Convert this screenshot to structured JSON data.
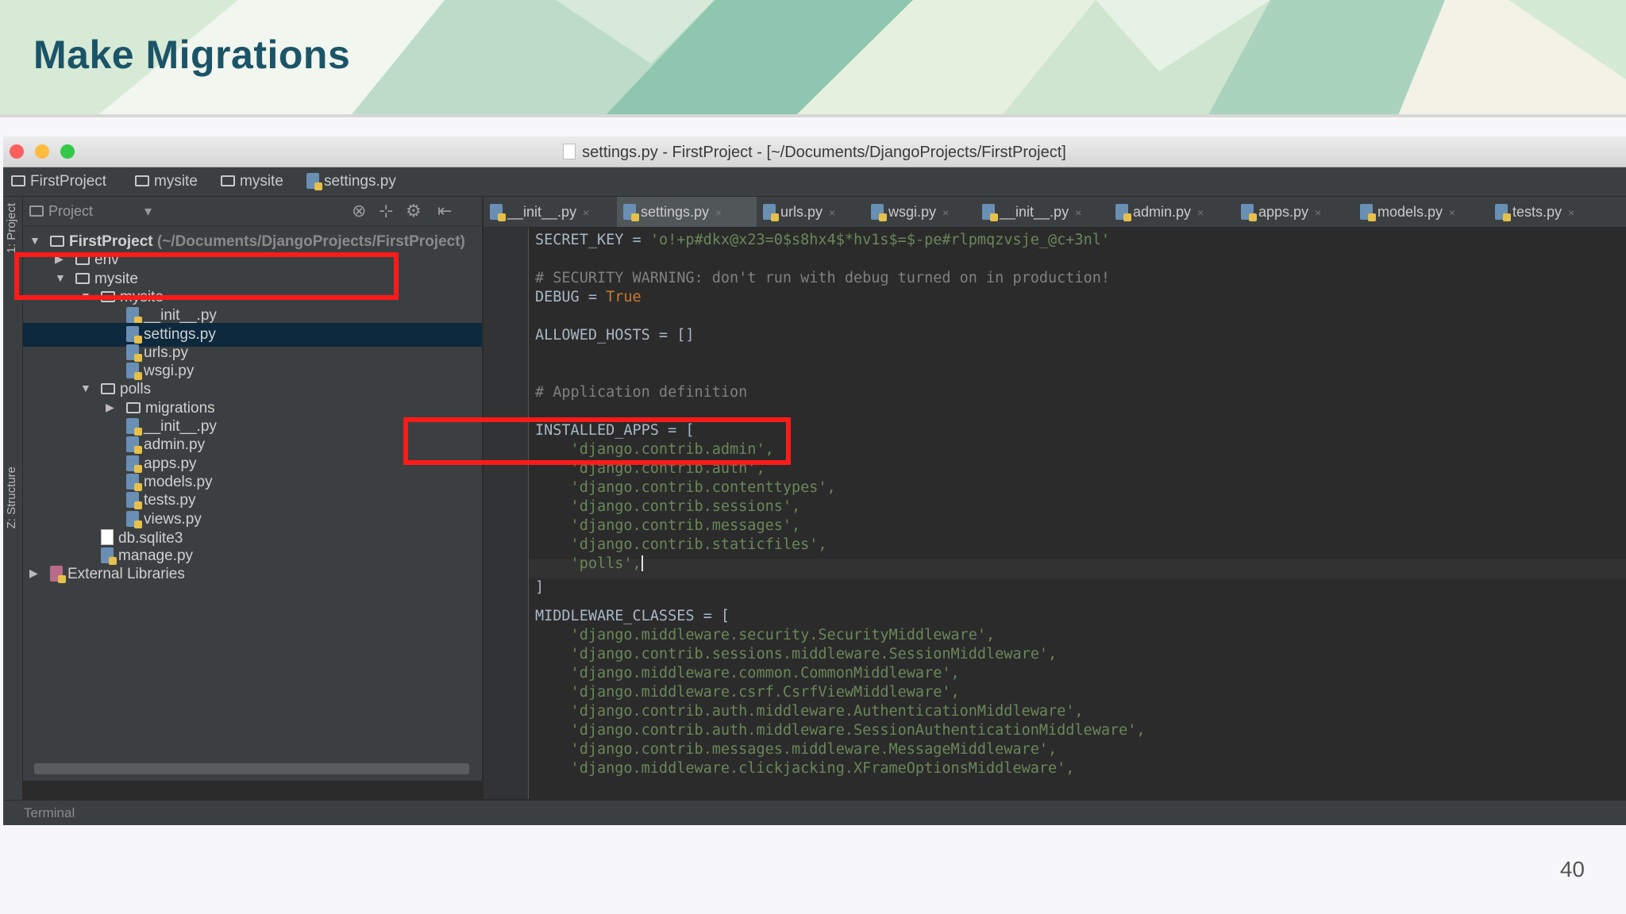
{
  "slide": {
    "title": "Make Migrations",
    "page_number": "40"
  },
  "window": {
    "title": "settings.py - FirstProject - [~/Documents/DjangoProjects/FirstProject]"
  },
  "breadcrumb": [
    "FirstProject",
    "mysite",
    "mysite",
    "settings.py"
  ],
  "side_tabs": {
    "project": "1: Project",
    "structure": "Z: Structure"
  },
  "project_panel": {
    "header_label": "Project",
    "tree": [
      {
        "label": "FirstProject",
        "suffix": "(~/Documents/DjangoProjects/FirstProject)",
        "depth": 0,
        "arrow": "▼",
        "kind": "folder"
      },
      {
        "label": "env",
        "depth": 1,
        "arrow": "▶",
        "kind": "folder"
      },
      {
        "label": "mysite",
        "depth": 1,
        "arrow": "▼",
        "kind": "folder"
      },
      {
        "label": "mysite",
        "depth": 2,
        "arrow": "▼",
        "kind": "folder"
      },
      {
        "label": "__init__.py",
        "depth": 3,
        "kind": "py"
      },
      {
        "label": "settings.py",
        "depth": 3,
        "kind": "py",
        "selected": true
      },
      {
        "label": "urls.py",
        "depth": 3,
        "kind": "py"
      },
      {
        "label": "wsgi.py",
        "depth": 3,
        "kind": "py"
      },
      {
        "label": "polls",
        "depth": 2,
        "arrow": "▼",
        "kind": "folder"
      },
      {
        "label": "migrations",
        "depth": 3,
        "arrow": "▶",
        "kind": "folder"
      },
      {
        "label": "__init__.py",
        "depth": 3,
        "kind": "py"
      },
      {
        "label": "admin.py",
        "depth": 3,
        "kind": "py"
      },
      {
        "label": "apps.py",
        "depth": 3,
        "kind": "py"
      },
      {
        "label": "models.py",
        "depth": 3,
        "kind": "py"
      },
      {
        "label": "tests.py",
        "depth": 3,
        "kind": "py"
      },
      {
        "label": "views.py",
        "depth": 3,
        "kind": "py"
      },
      {
        "label": "db.sqlite3",
        "depth": 2,
        "kind": "file"
      },
      {
        "label": "manage.py",
        "depth": 2,
        "kind": "py"
      },
      {
        "label": "External Libraries",
        "depth": 0,
        "arrow": "▶",
        "kind": "lib"
      }
    ]
  },
  "editor_tabs": [
    "__init__.py",
    "settings.py",
    "urls.py",
    "wsgi.py",
    "__init__.py",
    "admin.py",
    "apps.py",
    "models.py",
    "tests.py"
  ],
  "active_tab": "settings.py",
  "code": {
    "secret_key_name": "SECRET_KEY",
    "secret_key_value": "'o!+p#dkx@x23=0$s8hx4$*hv1s$=$-pe#rlpmqzvsje_@c+3nl'",
    "security_comment": "# SECURITY WARNING: don't run with debug turned on in production!",
    "debug_name": "DEBUG",
    "debug_value": "True",
    "allowed_hosts": "ALLOWED_HOSTS = []",
    "app_def_comment": "# Application definition",
    "installed_apps_open": "INSTALLED_APPS = [",
    "installed_apps": [
      "'django.contrib.admin',",
      "'django.contrib.auth',",
      "'django.contrib.contenttypes',",
      "'django.contrib.sessions',",
      "'django.contrib.messages',",
      "'django.contrib.staticfiles',",
      "'polls',"
    ],
    "close_bracket": "]",
    "middleware_open": "MIDDLEWARE_CLASSES = [",
    "middleware": [
      "'django.middleware.security.SecurityMiddleware',",
      "'django.contrib.sessions.middleware.SessionMiddleware',",
      "'django.middleware.common.CommonMiddleware',",
      "'django.middleware.csrf.CsrfViewMiddleware',",
      "'django.contrib.auth.middleware.AuthenticationMiddleware',",
      "'django.contrib.auth.middleware.SessionAuthenticationMiddleware',",
      "'django.contrib.messages.middleware.MessageMiddleware',",
      "'django.middleware.clickjacking.XFrameOptionsMiddleware',"
    ]
  },
  "bottom_bar": {
    "terminal_label": "Terminal"
  },
  "colors": {
    "highlight": "#ff1a1a",
    "title": "#1b5468"
  }
}
